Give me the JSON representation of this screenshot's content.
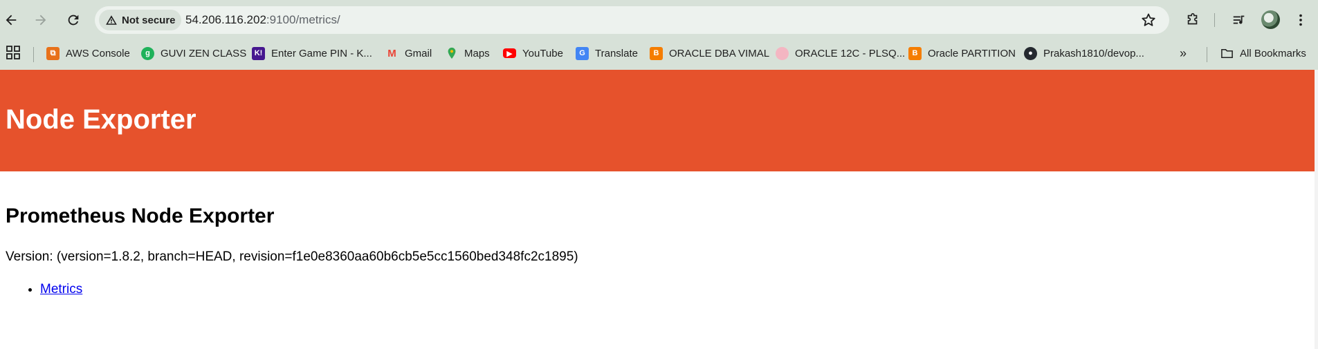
{
  "browser": {
    "security_label": "Not secure",
    "url_host": "54.206.116.202",
    "url_rest": ":9100/metrics/",
    "icons": [
      "back-icon",
      "forward-icon",
      "reload-icon",
      "warning-icon",
      "star-icon",
      "extensions-icon",
      "reading-list-icon",
      "profile-avatar",
      "kebab-menu-icon"
    ]
  },
  "bookmarks": {
    "items": [
      {
        "label": "AWS Console",
        "color": "#e8711a"
      },
      {
        "label": "GUVI ZEN CLASS",
        "color": "#1fb25a"
      },
      {
        "label": "Enter Game PIN - K...",
        "color": "#46178f"
      },
      {
        "label": "Gmail",
        "color": "#ea4335"
      },
      {
        "label": "Maps",
        "color": "#34a853"
      },
      {
        "label": "YouTube",
        "color": "#ff0000"
      },
      {
        "label": "Translate",
        "color": "#4285f4"
      },
      {
        "label": "ORACLE DBA VIMAL",
        "color": "#f57d00"
      },
      {
        "label": "ORACLE 12C - PLSQ...",
        "color": "#f4b6c2"
      },
      {
        "label": "Oracle PARTITION",
        "color": "#f57d00"
      },
      {
        "label": "Prakash1810/devop...",
        "color": "#24292f"
      }
    ],
    "all_bookmarks_label": "All Bookmarks"
  },
  "page": {
    "banner_title": "Node Exporter",
    "heading": "Prometheus Node Exporter",
    "version_text": "Version: (version=1.8.2, branch=HEAD, revision=f1e0e8360aa60b6cb5e5cc1560bed348fc2c1895)",
    "links": [
      {
        "label": "Metrics"
      }
    ],
    "banner_color": "#e6522c"
  }
}
